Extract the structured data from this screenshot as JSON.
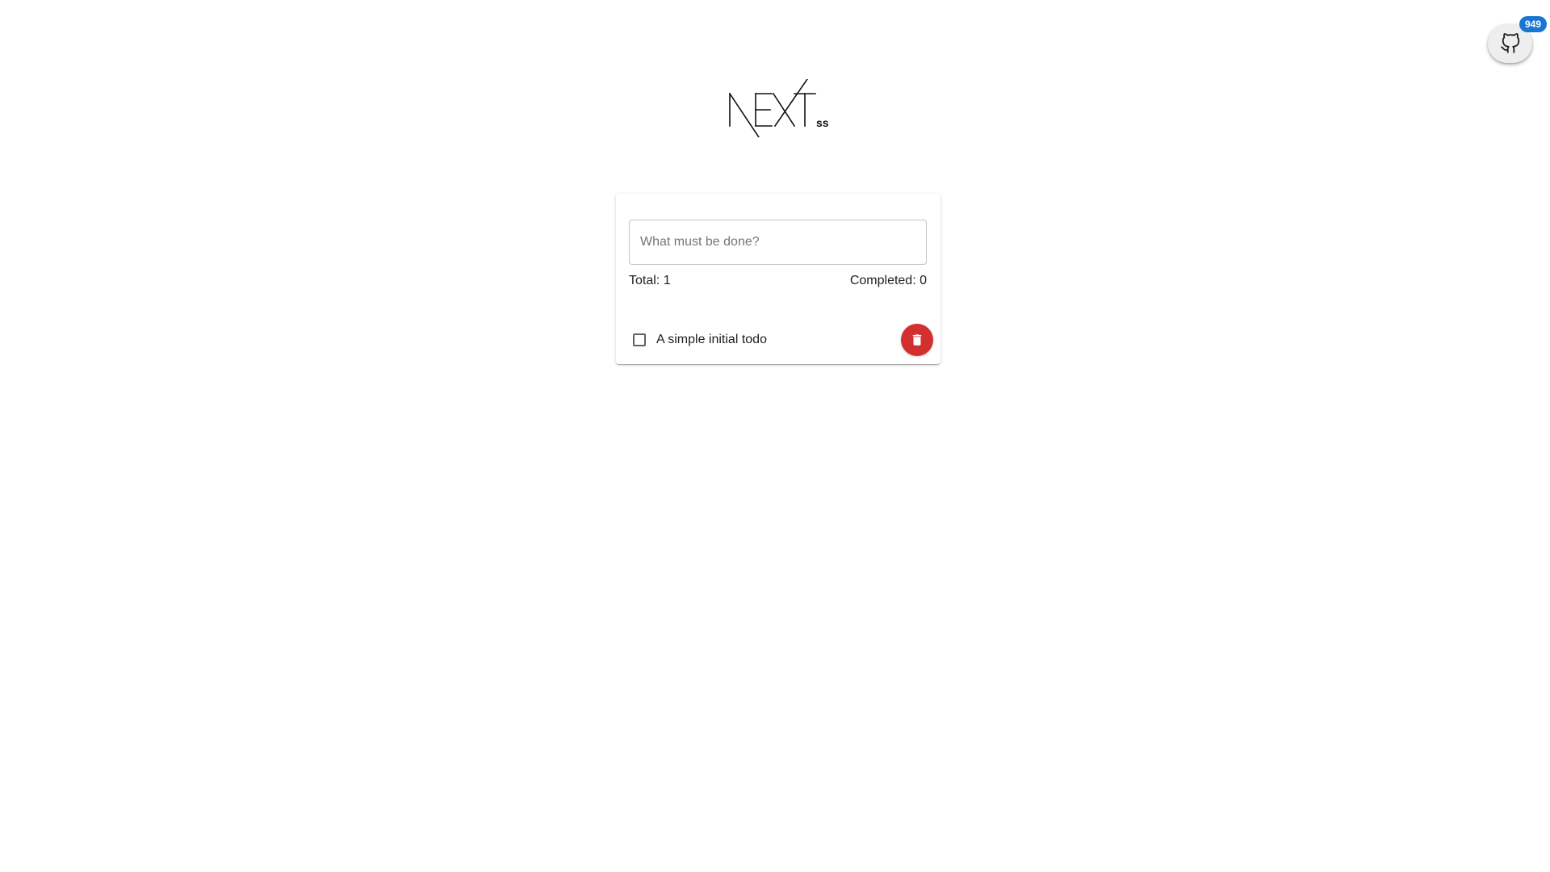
{
  "github": {
    "icon": "github-icon",
    "badge_count": "949",
    "badge_color": "#1976d2"
  },
  "logo": {
    "icon": "nextss-logo"
  },
  "todo": {
    "input_placeholder": "What must be done?",
    "input_value": "",
    "total_label": "Total: 1",
    "completed_label": "Completed: 0",
    "items": [
      {
        "label": "A simple initial todo",
        "completed": false
      }
    ],
    "delete_icon": "trash-icon",
    "delete_color": "#d32f2f"
  }
}
